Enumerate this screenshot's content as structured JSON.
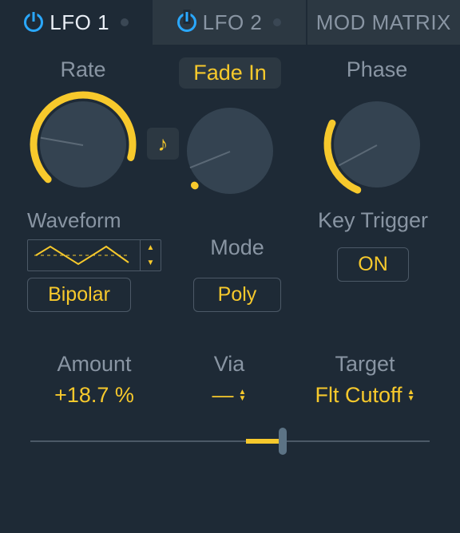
{
  "tabs": {
    "lfo1": {
      "label": "LFO 1",
      "active": true,
      "power": true,
      "has_mod": false
    },
    "lfo2": {
      "label": "LFO 2",
      "active": false,
      "power": true,
      "has_mod": false
    },
    "matrix": {
      "label": "MOD MATRIX"
    }
  },
  "knob_rate": {
    "label": "Rate",
    "angle_deg": 190,
    "arc_start_deg": 225,
    "arc_end_deg": 370
  },
  "knob_fade": {
    "label": "Fade In",
    "angle_deg": 158,
    "arc_start_deg": 225,
    "arc_end_deg": 225
  },
  "knob_phase": {
    "label": "Phase",
    "angle_deg": 152,
    "arc_start_deg": 225,
    "arc_end_deg": 200
  },
  "sync_note": {
    "on": true
  },
  "waveform": {
    "title": "Waveform",
    "polarity": "Bipolar"
  },
  "mode": {
    "title": "Mode",
    "value": "Poly"
  },
  "key_trigger": {
    "title": "Key Trigger",
    "value": "ON"
  },
  "mod_row": {
    "amount_label": "Amount",
    "amount_value": "+18.7 %",
    "via_label": "Via",
    "via_value": "—",
    "target_label": "Target",
    "target_value": "Flt Cutoff"
  },
  "slider": {
    "center_pct": 54,
    "thumb_pct": 63
  }
}
